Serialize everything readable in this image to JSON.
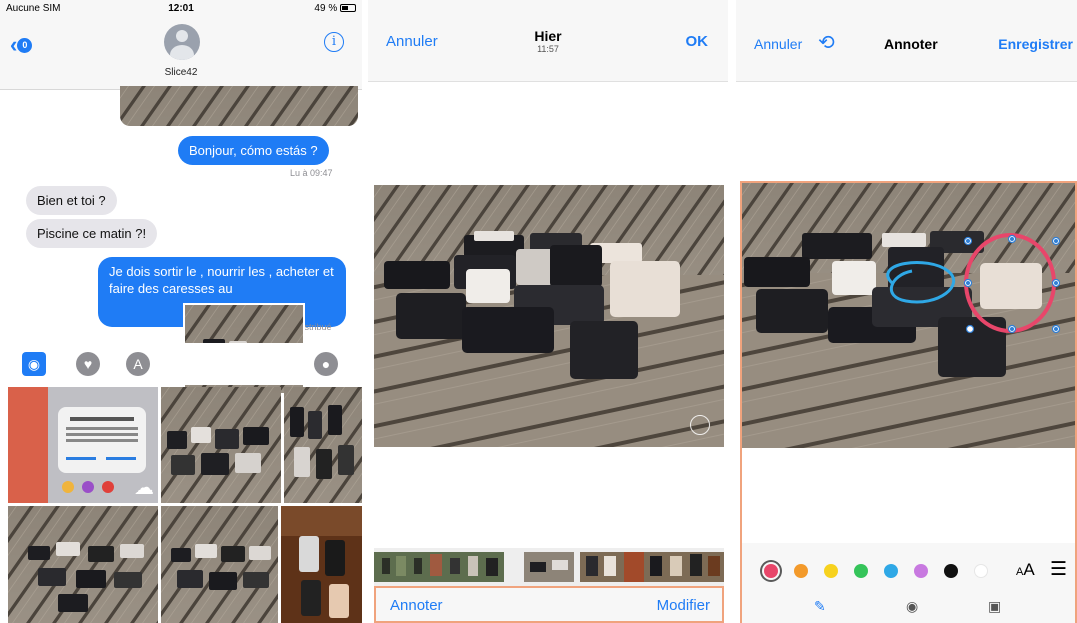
{
  "messages_screen": {
    "status": {
      "carrier": "Aucune SIM",
      "time": "12:01",
      "battery": "49 %"
    },
    "nav": {
      "back_badge": "0",
      "contact_name": "Slice42",
      "info_icon": "info-icon"
    },
    "bubbles": [
      {
        "text": "Bonjour, cómo estás ?",
        "side": "out"
      },
      {
        "text": "Bien et toi ?",
        "side": "in"
      },
      {
        "text": "Piscine ce matin ?!",
        "side": "in"
      },
      {
        "text": "Je dois sortir le , nourrir les , acheter et faire des caresses au",
        "side": "out"
      }
    ],
    "read_receipt": "Lu à 09:47",
    "delivered": "Distribué",
    "app_icons": [
      "camera-icon",
      "heart-touch-icon",
      "app-store-icon",
      "microphone-icon"
    ]
  },
  "photo_screen": {
    "nav": {
      "left": "Annuler",
      "title": "Hier",
      "subtitle": "11:57",
      "right": "OK"
    },
    "bottom": {
      "left": "Annoter",
      "right": "Modifier"
    }
  },
  "annotate_screen": {
    "nav": {
      "left": "Annuler",
      "title": "Annoter",
      "right": "Enregistrer",
      "undo_icon": "undo-icon"
    },
    "colors": [
      "#e8466a",
      "#f39a2b",
      "#f7d21e",
      "#35c45a",
      "#2fa8e6",
      "#c879e0",
      "#111111",
      "#ffffff"
    ],
    "selected_color": "#e8466a",
    "text_size_label": "AA",
    "tools": [
      "pen-icon",
      "magnifier-icon",
      "text-icon"
    ]
  }
}
